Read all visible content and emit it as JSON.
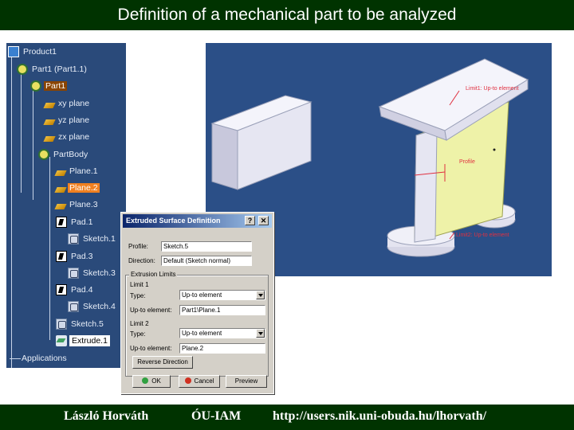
{
  "slide": {
    "title": "Definition of a mechanical part to be analyzed",
    "footer_author": "László Horváth",
    "footer_institution": "ÓU-IAM",
    "footer_url": "http://users.nik.uni-obuda.hu/lhorvath/"
  },
  "tree": {
    "nodes": [
      {
        "label": "Product1",
        "icon": "product-icon"
      },
      {
        "label": "Part1 (Part1.1)",
        "icon": "part-icon"
      },
      {
        "label": "Part1",
        "icon": "gear-icon"
      },
      {
        "label": "xy plane",
        "icon": "plane-icon"
      },
      {
        "label": "yz plane",
        "icon": "plane-icon"
      },
      {
        "label": "zx plane",
        "icon": "plane-icon"
      },
      {
        "label": "PartBody",
        "icon": "gear-icon"
      },
      {
        "label": "Plane.1",
        "icon": "plane-icon"
      },
      {
        "label": "Plane.2",
        "icon": "plane-icon"
      },
      {
        "label": "Plane.3",
        "icon": "plane-icon"
      },
      {
        "label": "Pad.1",
        "icon": "pad-icon"
      },
      {
        "label": "Sketch.1",
        "icon": "sketch-icon"
      },
      {
        "label": "Pad.3",
        "icon": "pad-icon"
      },
      {
        "label": "Sketch.3",
        "icon": "sketch-icon"
      },
      {
        "label": "Pad.4",
        "icon": "pad-icon"
      },
      {
        "label": "Sketch.4",
        "icon": "sketch-icon"
      },
      {
        "label": "Sketch.5",
        "icon": "sketch-icon"
      },
      {
        "label": "Extrude.1",
        "icon": "extrude-icon"
      },
      {
        "label": "Applications",
        "icon": "applications-icon"
      }
    ]
  },
  "viewport": {
    "label_limit1": "Limit1: Up-to element",
    "label_profile": "Profile",
    "label_limit2": "Limit2: Up-to element",
    "colors": {
      "background": "#2b4f87",
      "part": "#e8e8f6",
      "surface": "#eef2a8"
    }
  },
  "dialog": {
    "title": "Extruded Surface Definition",
    "help_button": "?",
    "close_button": "✕",
    "profile_label": "Profile:",
    "profile_value": "Sketch.5",
    "direction_label": "Direction:",
    "direction_value": "Default (Sketch normal)",
    "extrusion_limits_label": "Extrusion Limits",
    "limit1_label": "Limit 1",
    "limit1_type_label": "Type:",
    "limit1_type_value": "Up-to element",
    "limit1_element_label": "Up-to element:",
    "limit1_element_value": "Part1\\Plane.1",
    "limit2_label": "Limit 2",
    "limit2_type_label": "Type:",
    "limit2_type_value": "Up-to element",
    "limit2_element_label": "Up-to element:",
    "limit2_element_value": "Plane.2",
    "reverse_button": "Reverse Direction",
    "ok_button": "OK",
    "cancel_button": "Cancel",
    "preview_button": "Preview"
  }
}
